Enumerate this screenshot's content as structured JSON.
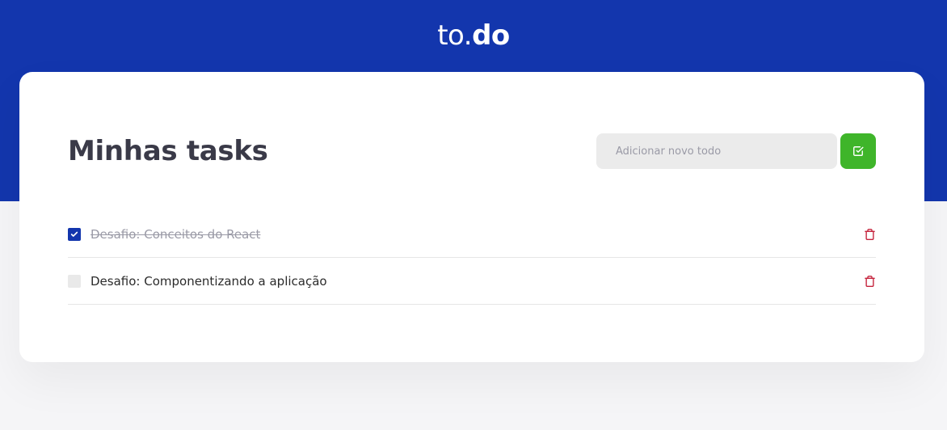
{
  "header": {
    "logo_prefix": "to.",
    "logo_suffix": "do"
  },
  "main": {
    "title": "Minhas tasks",
    "input": {
      "placeholder": "Adicionar novo todo",
      "value": ""
    },
    "add_button_icon": "check-square-icon"
  },
  "tasks": [
    {
      "title": "Desafio: Conceitos do React",
      "completed": true,
      "delete_icon": "trash-icon"
    },
    {
      "title": "Desafio: Componentizando a aplicação",
      "completed": false,
      "delete_icon": "trash-icon"
    }
  ],
  "colors": {
    "header_bg": "#1336ad",
    "accent_blue": "#1336ad",
    "add_button_green": "#3fb52a",
    "delete_red": "#c5233c",
    "title_text": "#3a3a48",
    "input_bg": "#ebebeb"
  }
}
